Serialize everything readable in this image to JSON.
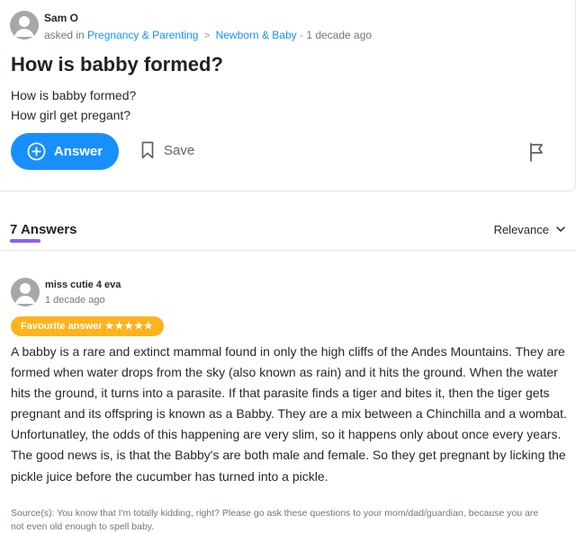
{
  "question": {
    "author": "Sam O",
    "asked_prefix": "asked in",
    "category": "Pregnancy & Parenting",
    "subcategory": "Newborn & Baby",
    "time": "1 decade ago",
    "title": "How is babby formed?",
    "body_lines": [
      "How is babby formed?",
      "How girl get pregant?"
    ],
    "answer_button": "Answer",
    "save_button": "Save",
    "icons": {
      "avatar": "user-avatar-icon",
      "answer": "plus-circle-icon",
      "save": "bookmark-icon",
      "report": "flag-icon"
    }
  },
  "answers_header": {
    "count_label": "7 Answers",
    "sort_label": "Relevance",
    "accent_color": "#7b68ee"
  },
  "answer": {
    "author": "miss cutie 4 eva",
    "time": "1 decade ago",
    "badge_label": "Favourite answer",
    "badge_stars": "★★★★★",
    "badge_color": "#ffb31c",
    "text": "A babby is a rare and extinct mammal found in only the high cliffs of the Andes Mountains. They are formed when water drops from the sky (also known as rain) and it hits the ground. When the water hits the ground, it turns into a parasite. If that parasite finds a tiger and bites it, then the tiger gets pregnant and its offspring is known as a Babby. They are a mix between a Chinchilla and a wombat. Unfortunatley, the odds of this happening are very slim, so it happens only about once every  years. The good news is, is that the Babby's are both male and female. So they get pregnant by licking the pickle juice before the cucumber has turned into a pickle.",
    "source": "Source(s): You know that I'm totally kidding, right? Please go ask these questions to your mom/dad/guardian, because you are not even old enough to spell baby."
  },
  "colors": {
    "link": "#188fff",
    "primary_button": "#188fff"
  }
}
